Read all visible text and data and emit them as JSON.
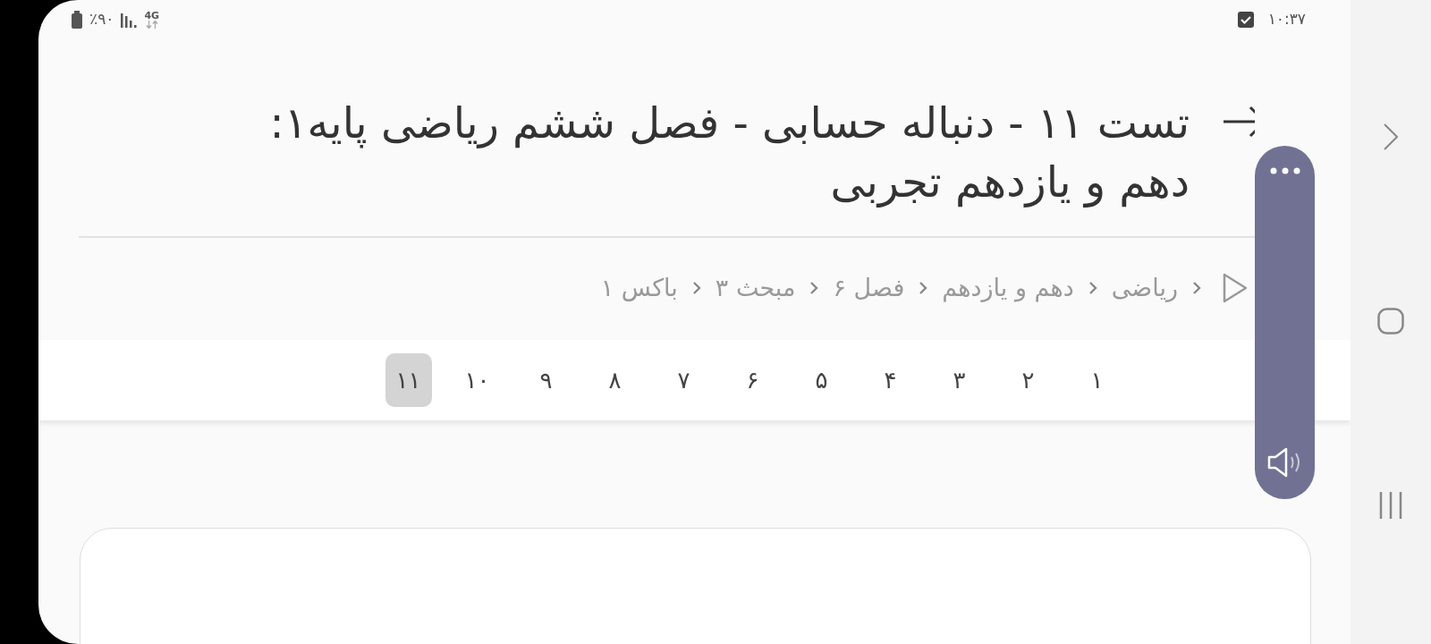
{
  "status_bar": {
    "battery": "٪۹۰",
    "network": "4G",
    "time": "۱۰:۳۷"
  },
  "title": "تست ۱۱ - دنباله حسابی - فصل ششم ریاضی پایه۱: دهم و یازدهم تجربی",
  "breadcrumb": [
    "ریاضی",
    "دهم و یازدهم",
    "فصل ۶",
    "مبحث ۳",
    "باکس ۱"
  ],
  "pages": [
    {
      "label": "۱",
      "selected": false
    },
    {
      "label": "۲",
      "selected": false
    },
    {
      "label": "۳",
      "selected": false
    },
    {
      "label": "۴",
      "selected": false
    },
    {
      "label": "۵",
      "selected": false
    },
    {
      "label": "۶",
      "selected": false
    },
    {
      "label": "۷",
      "selected": false
    },
    {
      "label": "۸",
      "selected": false
    },
    {
      "label": "۹",
      "selected": false
    },
    {
      "label": "۱۰",
      "selected": false
    },
    {
      "label": "۱۱",
      "selected": true
    }
  ]
}
